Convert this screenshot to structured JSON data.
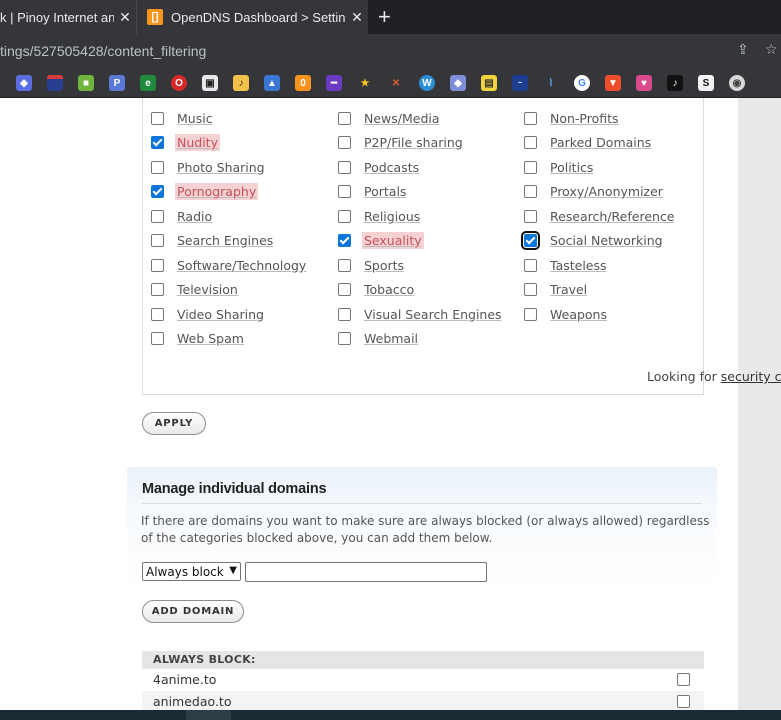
{
  "browser": {
    "tabs": [
      {
        "title": "k | Pinoy Internet an",
        "active": false
      },
      {
        "title": "OpenDNS Dashboard > Settings",
        "active": true
      }
    ],
    "tab_close_glyph": "✕",
    "new_tab_glyph": "+",
    "opendns_favicon": "[]",
    "url": "tings/527505428/content_filtering",
    "bookmark_icons": [
      "app-icon",
      "flag-icon",
      "box-icon",
      "parking-icon",
      "leaf-icon",
      "opera-icon",
      "screen-icon",
      "music-icon",
      "drive-icon",
      "opendns-icon",
      "purple-icon",
      "star-icon",
      "blade-icon",
      "wordpress-icon",
      "cube-icon",
      "yellow-icon",
      "weather-icon",
      "chart-icon",
      "google-icon",
      "bag-icon",
      "heart-icon",
      "tiktok-icon",
      "s-icon",
      "globe-icon"
    ]
  },
  "categories": {
    "items": [
      {
        "label": "Music",
        "checked": false,
        "flagged": false
      },
      {
        "label": "News/Media",
        "checked": false,
        "flagged": false
      },
      {
        "label": "Non-Profits",
        "checked": false,
        "flagged": false
      },
      {
        "label": "Nudity",
        "checked": true,
        "flagged": true
      },
      {
        "label": "P2P/File sharing",
        "checked": false,
        "flagged": false
      },
      {
        "label": "Parked Domains",
        "checked": false,
        "flagged": false
      },
      {
        "label": "Photo Sharing",
        "checked": false,
        "flagged": false
      },
      {
        "label": "Podcasts",
        "checked": false,
        "flagged": false
      },
      {
        "label": "Politics",
        "checked": false,
        "flagged": false
      },
      {
        "label": "Pornography",
        "checked": true,
        "flagged": true
      },
      {
        "label": "Portals",
        "checked": false,
        "flagged": false
      },
      {
        "label": "Proxy/Anonymizer",
        "checked": false,
        "flagged": false
      },
      {
        "label": "Radio",
        "checked": false,
        "flagged": false
      },
      {
        "label": "Religious",
        "checked": false,
        "flagged": false
      },
      {
        "label": "Research/Reference",
        "checked": false,
        "flagged": false
      },
      {
        "label": "Search Engines",
        "checked": false,
        "flagged": false
      },
      {
        "label": "Sexuality",
        "checked": true,
        "flagged": true
      },
      {
        "label": "Social Networking",
        "checked": true,
        "flagged": false,
        "focused": true
      },
      {
        "label": "Software/Technology",
        "checked": false,
        "flagged": false
      },
      {
        "label": "Sports",
        "checked": false,
        "flagged": false
      },
      {
        "label": "Tasteless",
        "checked": false,
        "flagged": false
      },
      {
        "label": "Television",
        "checked": false,
        "flagged": false
      },
      {
        "label": "Tobacco",
        "checked": false,
        "flagged": false
      },
      {
        "label": "Travel",
        "checked": false,
        "flagged": false
      },
      {
        "label": "Video Sharing",
        "checked": false,
        "flagged": false
      },
      {
        "label": "Visual Search Engines",
        "checked": false,
        "flagged": false
      },
      {
        "label": "Weapons",
        "checked": false,
        "flagged": false
      },
      {
        "label": "Web Spam",
        "checked": false,
        "flagged": false
      },
      {
        "label": "Webmail",
        "checked": false,
        "flagged": false
      }
    ],
    "looking_prefix": "Looking for ",
    "looking_link": "security categories",
    "looking_suffix": "?"
  },
  "apply_label": "APPLY",
  "manage": {
    "title": "Manage individual domains",
    "description": "If there are domains you want to make sure are always blocked (or always allowed) regardless of the categories blocked above, you can add them below.",
    "select_value": "Always block",
    "domain_input_value": "",
    "add_domain_label": "ADD DOMAIN"
  },
  "always_block": {
    "header": "ALWAYS BLOCK:",
    "domains": [
      "4anime.to",
      "animedao.to"
    ]
  },
  "colors": {
    "checkbox_checked": "#0b75d9",
    "flag_bg": "#f6d1d4",
    "flag_text": "#c4525b"
  }
}
